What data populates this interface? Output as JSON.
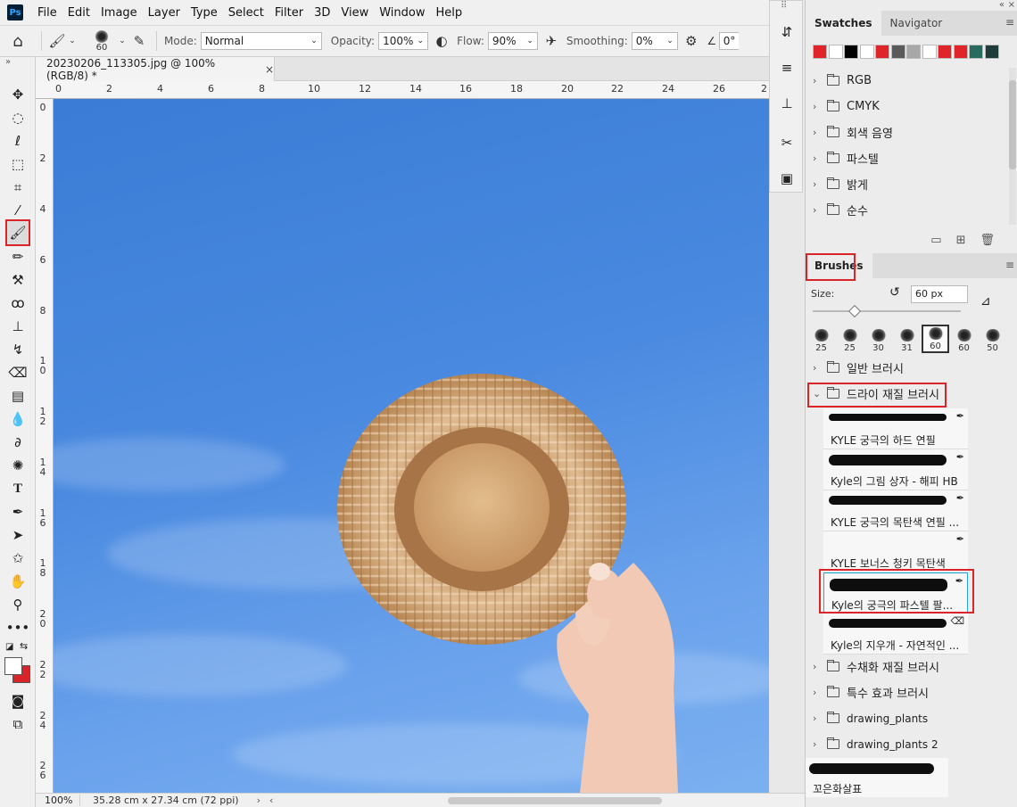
{
  "app": {
    "logo_text": "Ps"
  },
  "menu": [
    "File",
    "Edit",
    "Image",
    "Layer",
    "Type",
    "Select",
    "Filter",
    "3D",
    "View",
    "Window",
    "Help"
  ],
  "options": {
    "brush_size": "60",
    "mode_label": "Mode:",
    "mode_value": "Normal",
    "opacity_label": "Opacity:",
    "opacity_value": "100%",
    "flow_label": "Flow:",
    "flow_value": "90%",
    "smoothing_label": "Smoothing:",
    "smoothing_value": "0%",
    "angle_value": "0°"
  },
  "document": {
    "tab_title": "20230206_113305.jpg @ 100% (RGB/8) *",
    "zoom": "100%",
    "doc_info": "35.28 cm x 27.34 cm (72 ppi)"
  },
  "rulers": {
    "top": [
      "0",
      "2",
      "4",
      "6",
      "8",
      "10",
      "12",
      "14",
      "16",
      "18",
      "20",
      "22",
      "24",
      "26",
      "2"
    ],
    "left": [
      "0",
      "2",
      "4",
      "6",
      "8",
      "1\n0",
      "1\n2",
      "1\n4",
      "1\n6",
      "1\n8",
      "2\n0",
      "2\n2",
      "2\n4",
      "2\n6"
    ]
  },
  "swatches_panel": {
    "tabs": [
      "Swatches",
      "Navigator"
    ],
    "colors": [
      "#e0252a",
      "#ffffff",
      "#000000",
      "#ffffff",
      "#e0252a",
      "#5a5a5a",
      "#a8a8a8",
      "#ffffff",
      "#e0252a",
      "#e0252a",
      "#2a6a5e",
      "#1e3d3a"
    ],
    "folders": [
      "RGB",
      "CMYK",
      "회색 음영",
      "파스텔",
      "밝게",
      "순수"
    ]
  },
  "brushes_panel": {
    "title": "Brushes",
    "size_label": "Size:",
    "size_value": "60 px",
    "presets": [
      "25",
      "25",
      "30",
      "31",
      "60",
      "60",
      "50"
    ],
    "folders_top": [
      "일반 브러시"
    ],
    "open_folder": "드라이 재질 브러시",
    "brushes": [
      "KYLE 궁극의 하드 연필",
      "Kyle의 그림 상자 - 해피 HB",
      "KYLE 궁극의 목탄색 연필 ...",
      "KYLE 보너스 청키 목탄색",
      "Kyle의 궁극의 파스텔 팔...",
      "Kyle의 지우개 - 자연적인 ..."
    ],
    "folders_bottom": [
      "수채화 재질 브러시",
      "특수 효과 브러시",
      "drawing_plants",
      "drawing_plants 2"
    ],
    "loose_brush": "꼬은화살표"
  }
}
